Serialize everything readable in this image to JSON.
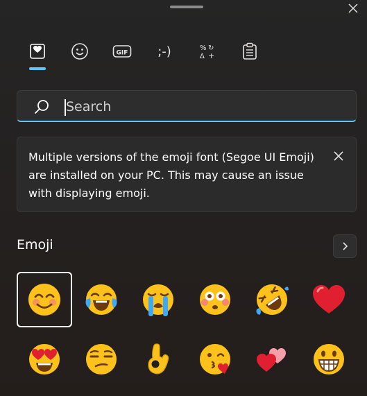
{
  "tabs": [
    {
      "name": "favorites-tab",
      "icon": "heart-board-icon"
    },
    {
      "name": "emoji-tab",
      "icon": "smiley-icon"
    },
    {
      "name": "gif-tab",
      "icon": "gif-icon",
      "label": "GIF"
    },
    {
      "name": "kaomoji-tab",
      "icon": "kaomoji-icon",
      "label": ";-)"
    },
    {
      "name": "symbols-tab",
      "icon": "symbols-icon"
    },
    {
      "name": "clipboard-tab",
      "icon": "clipboard-icon"
    }
  ],
  "search": {
    "placeholder": "Search",
    "value": ""
  },
  "banner": {
    "message": "Multiple versions of the emoji font (Segoe UI Emoji) are installed on your PC. This may cause an issue with displaying emoji."
  },
  "section": {
    "title": "Emoji"
  },
  "emoji": [
    "smiling-face-with-smiling-eyes",
    "face-with-tears-of-joy",
    "loudly-crying-face",
    "flushed-face",
    "rolling-on-the-floor-laughing",
    "red-heart",
    "smiling-face-with-heart-eyes",
    "unamused-face",
    "ok-hand",
    "face-blowing-a-kiss",
    "two-hearts",
    "grinning-face-with-big-eyes"
  ],
  "colors": {
    "accent": "#5ec9f4",
    "background": "#241f1d",
    "emoji_yellow": "#fcc21b",
    "emoji_red": "#e02030"
  }
}
